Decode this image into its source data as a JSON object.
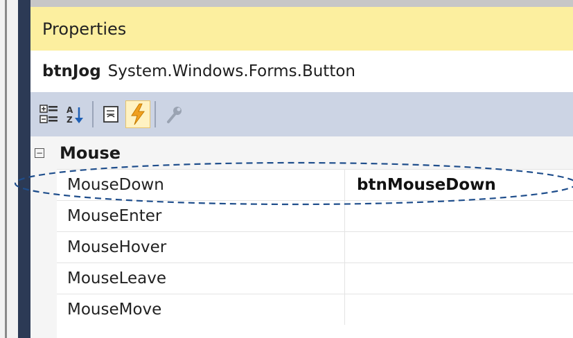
{
  "panel": {
    "title": "Properties",
    "object_name": "btnJog",
    "object_type": "System.Windows.Forms.Button"
  },
  "toolbar": {
    "buttons": [
      {
        "icon": "categorized-icon",
        "active": false
      },
      {
        "icon": "alphabetical-sort-icon",
        "active": false
      },
      {
        "icon": "properties-page-icon",
        "active": false
      },
      {
        "icon": "events-lightning-icon",
        "active": true
      },
      {
        "icon": "property-pages-wrench-icon",
        "active": false
      }
    ]
  },
  "grid": {
    "category": {
      "label": "Mouse",
      "toggle": "⊟"
    },
    "rows": [
      {
        "name": "MouseDown",
        "value": "btnMouseDown"
      },
      {
        "name": "MouseEnter",
        "value": ""
      },
      {
        "name": "MouseHover",
        "value": ""
      },
      {
        "name": "MouseLeave",
        "value": ""
      },
      {
        "name": "MouseMove",
        "value": ""
      }
    ]
  },
  "colors": {
    "title_bg": "#fcef9f",
    "toolbar_bg": "#ccd4e4",
    "highlight_ellipse": "#1f4e8c",
    "lightning": "#f0a020"
  }
}
